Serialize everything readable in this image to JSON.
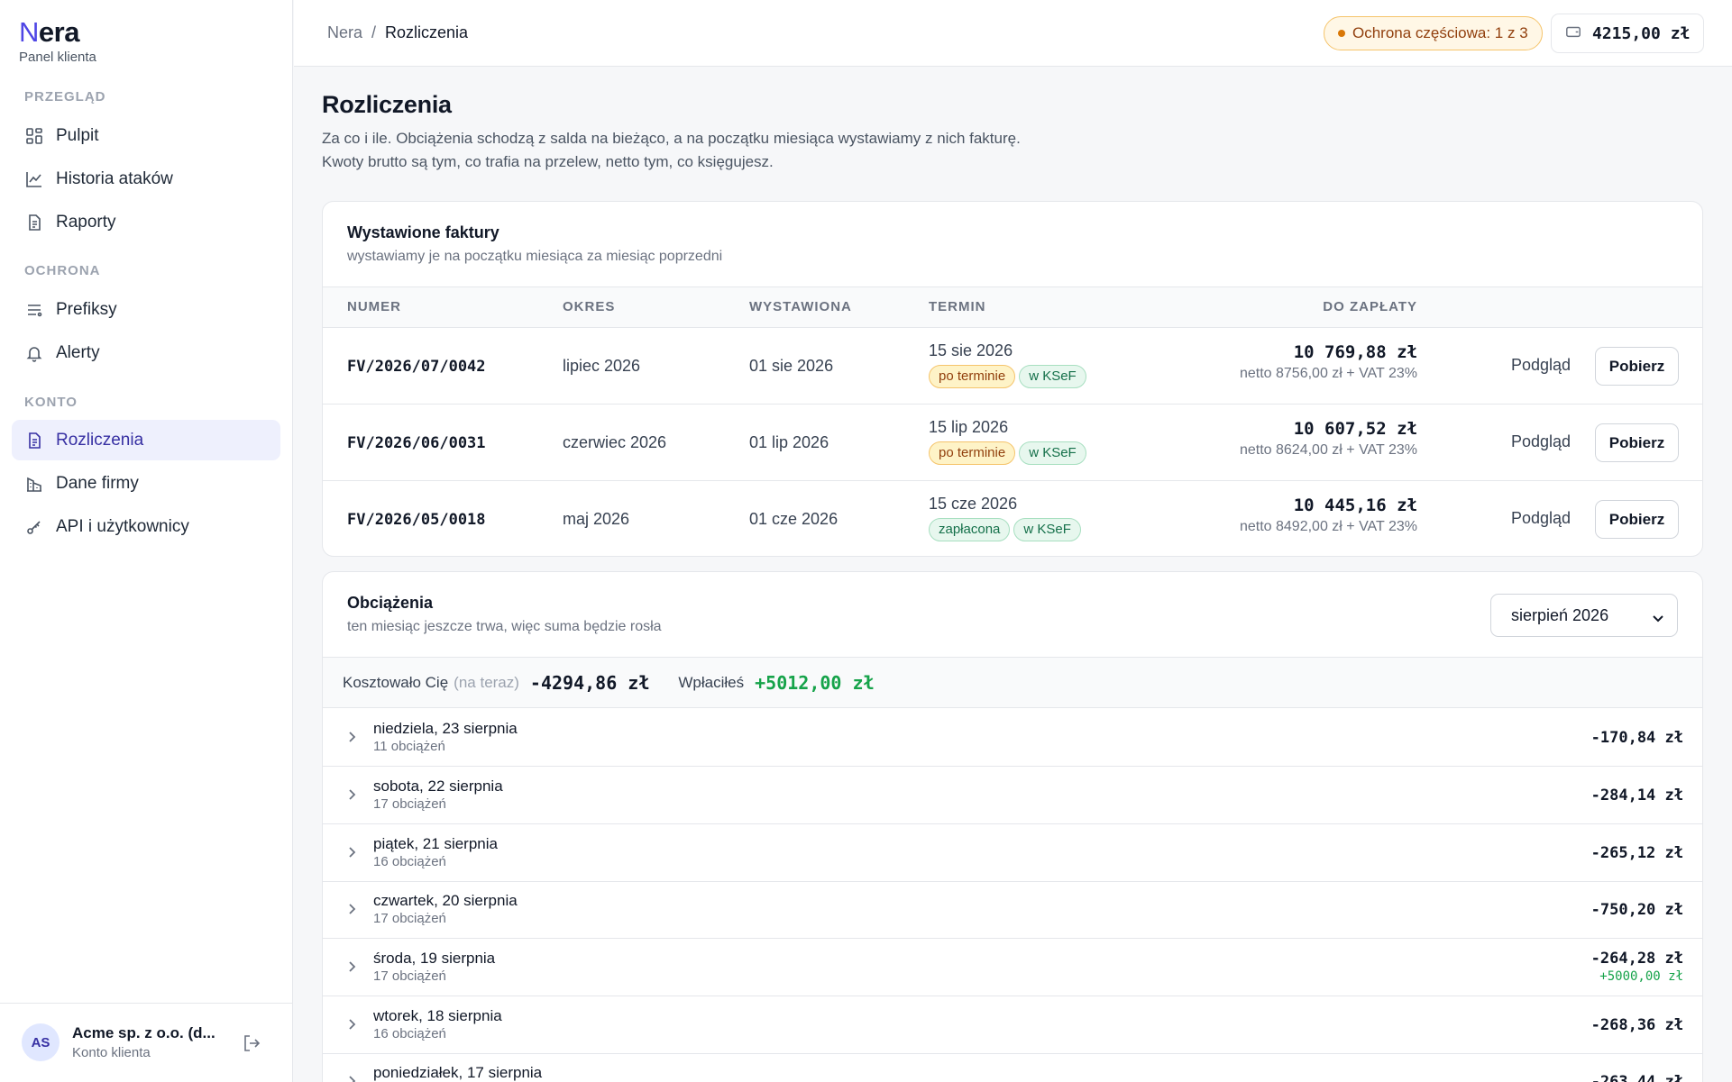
{
  "brand": {
    "name_first": "N",
    "name_rest": "era",
    "subtitle": "Panel klienta"
  },
  "sidebar": {
    "sections": [
      {
        "label": "PRZEGLĄD"
      },
      {
        "label": "OCHRONA"
      },
      {
        "label": "KONTO"
      }
    ],
    "items": [
      {
        "label": "Pulpit",
        "icon": "dashboard-icon"
      },
      {
        "label": "Historia ataków",
        "icon": "chart-line-icon"
      },
      {
        "label": "Raporty",
        "icon": "document-icon"
      },
      {
        "label": "Prefiksy",
        "icon": "list-icon"
      },
      {
        "label": "Alerty",
        "icon": "bell-icon"
      },
      {
        "label": "Rozliczenia",
        "icon": "invoice-icon",
        "active": true
      },
      {
        "label": "Dane firmy",
        "icon": "building-icon"
      },
      {
        "label": "API i użytkownicy",
        "icon": "key-icon"
      }
    ],
    "account": {
      "initials": "AS",
      "name": "Acme sp. z o.o. (d...",
      "role": "Konto klienta"
    }
  },
  "topbar": {
    "breadcrumb": {
      "root": "Nera",
      "separator": "/",
      "current": "Rozliczenia"
    },
    "protection_badge": "Ochrona częściowa: 1 z 3",
    "balance": "4215,00 zł"
  },
  "page": {
    "title": "Rozliczenia",
    "desc_line1": "Za co i ile. Obciążenia schodzą z salda na bieżąco, a na początku miesiąca wystawiamy z nich fakturę.",
    "desc_line2": "Kwoty brutto są tym, co trafia na przelew, netto tym, co księgujesz."
  },
  "invoices": {
    "title": "Wystawione faktury",
    "subtitle": "wystawiamy je na początku miesiąca za miesiąc poprzedni",
    "columns": [
      "NUMER",
      "OKRES",
      "WYSTAWIONA",
      "TERMIN",
      "DO ZAPŁATY"
    ],
    "preview_label": "Podgląd",
    "download_label": "Pobierz",
    "rows": [
      {
        "number": "FV/2026/07/0042",
        "period": "lipiec 2026",
        "issued": "01 sie 2026",
        "due": "15 sie 2026",
        "status": "po terminie",
        "status_kind": "late",
        "ksef": "w KSeF",
        "gross": "10 769,88 zł",
        "net": "netto 8756,00 zł + VAT 23%"
      },
      {
        "number": "FV/2026/06/0031",
        "period": "czerwiec 2026",
        "issued": "01 lip 2026",
        "due": "15 lip 2026",
        "status": "po terminie",
        "status_kind": "late",
        "ksef": "w KSeF",
        "gross": "10 607,52 zł",
        "net": "netto 8624,00 zł + VAT 23%"
      },
      {
        "number": "FV/2026/05/0018",
        "period": "maj 2026",
        "issued": "01 cze 2026",
        "due": "15 cze 2026",
        "status": "zapłacona",
        "status_kind": "paid",
        "ksef": "w KSeF",
        "gross": "10 445,16 zł",
        "net": "netto 8492,00 zł + VAT 23%"
      }
    ]
  },
  "charges": {
    "title": "Obciążenia",
    "subtitle": "ten miesiąc jeszcze trwa, więc suma będzie rosła",
    "month_select": "sierpień 2026",
    "summary": {
      "cost_label": "Kosztowało Cię",
      "cost_note": "(na teraz)",
      "cost_value": "-4294,86 zł",
      "paid_label": "Wpłaciłeś",
      "paid_value": "+5012,00 zł"
    },
    "days": [
      {
        "title": "niedziela, 23 sierpnia",
        "count": "11 obciążeń",
        "amount": "-170,84 zł",
        "topup": ""
      },
      {
        "title": "sobota, 22 sierpnia",
        "count": "17 obciążeń",
        "amount": "-284,14 zł",
        "topup": ""
      },
      {
        "title": "piątek, 21 sierpnia",
        "count": "16 obciążeń",
        "amount": "-265,12 zł",
        "topup": ""
      },
      {
        "title": "czwartek, 20 sierpnia",
        "count": "17 obciążeń",
        "amount": "-750,20 zł",
        "topup": ""
      },
      {
        "title": "środa, 19 sierpnia",
        "count": "17 obciążeń",
        "amount": "-264,28 zł",
        "topup": "+5000,00 zł"
      },
      {
        "title": "wtorek, 18 sierpnia",
        "count": "16 obciążeń",
        "amount": "-268,36 zł",
        "topup": ""
      },
      {
        "title": "poniedziałek, 17 sierpnia",
        "count": "",
        "amount": "-263,44 zł",
        "topup": ""
      }
    ]
  }
}
